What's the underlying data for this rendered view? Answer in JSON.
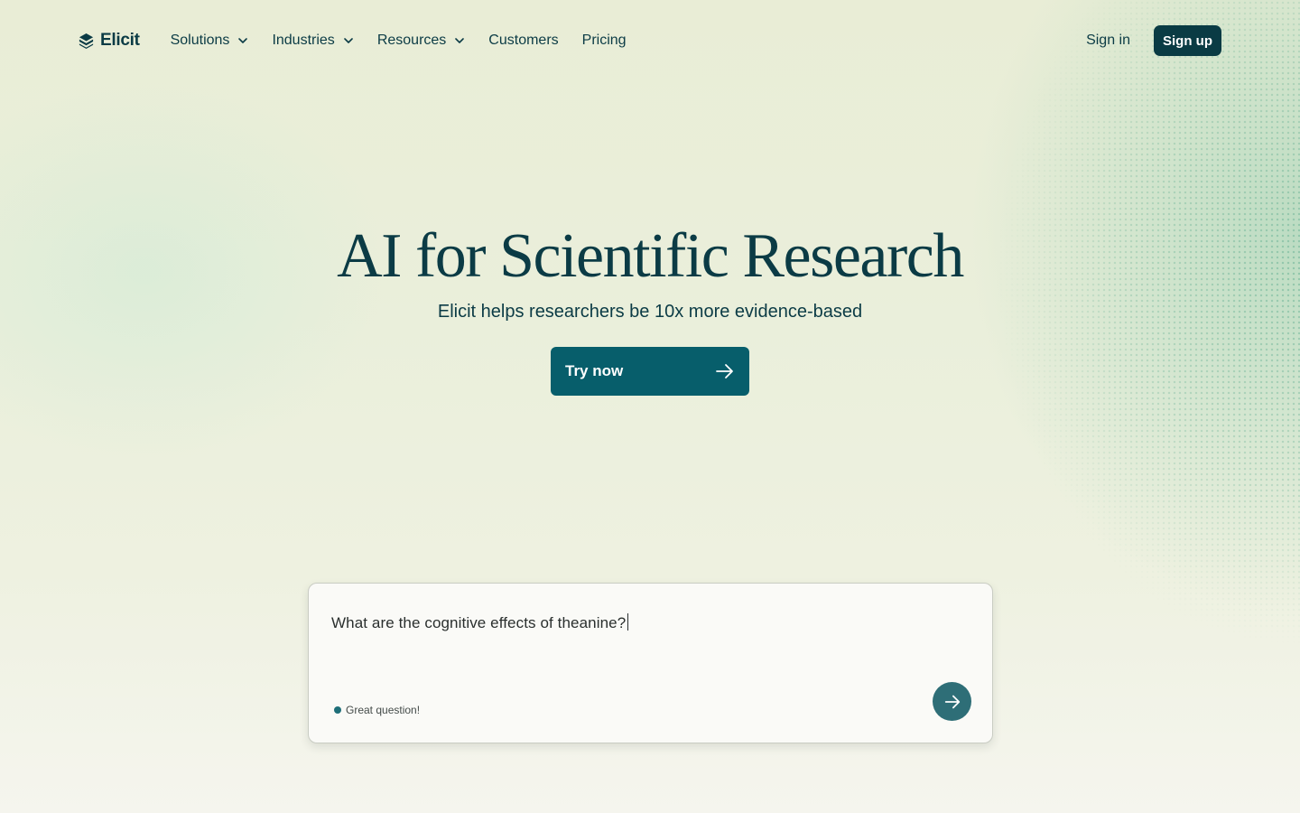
{
  "brand": {
    "name": "Elicit",
    "logo_icon": "elicit-logo-icon"
  },
  "nav": {
    "items": [
      {
        "label": "Solutions",
        "dropdown": true
      },
      {
        "label": "Industries",
        "dropdown": true
      },
      {
        "label": "Resources",
        "dropdown": true
      },
      {
        "label": "Customers",
        "dropdown": false
      },
      {
        "label": "Pricing",
        "dropdown": false
      }
    ],
    "sign_in": "Sign in",
    "sign_up": "Sign up"
  },
  "hero": {
    "title": "AI for Scientific Research",
    "subtitle": "Elicit helps researchers be 10x more evidence-based",
    "cta_label": "Try now",
    "cta_icon": "arrow-right-icon"
  },
  "search": {
    "query": "What are the cognitive effects of theanine?",
    "status_text": "Great question!",
    "submit_icon": "arrow-right-icon"
  },
  "colors": {
    "primary_dark": "#0a3b44",
    "cta_teal": "#075e6b",
    "submit_teal": "#2e6e77",
    "text": "#0b3b45",
    "background": "#eaefdb"
  }
}
